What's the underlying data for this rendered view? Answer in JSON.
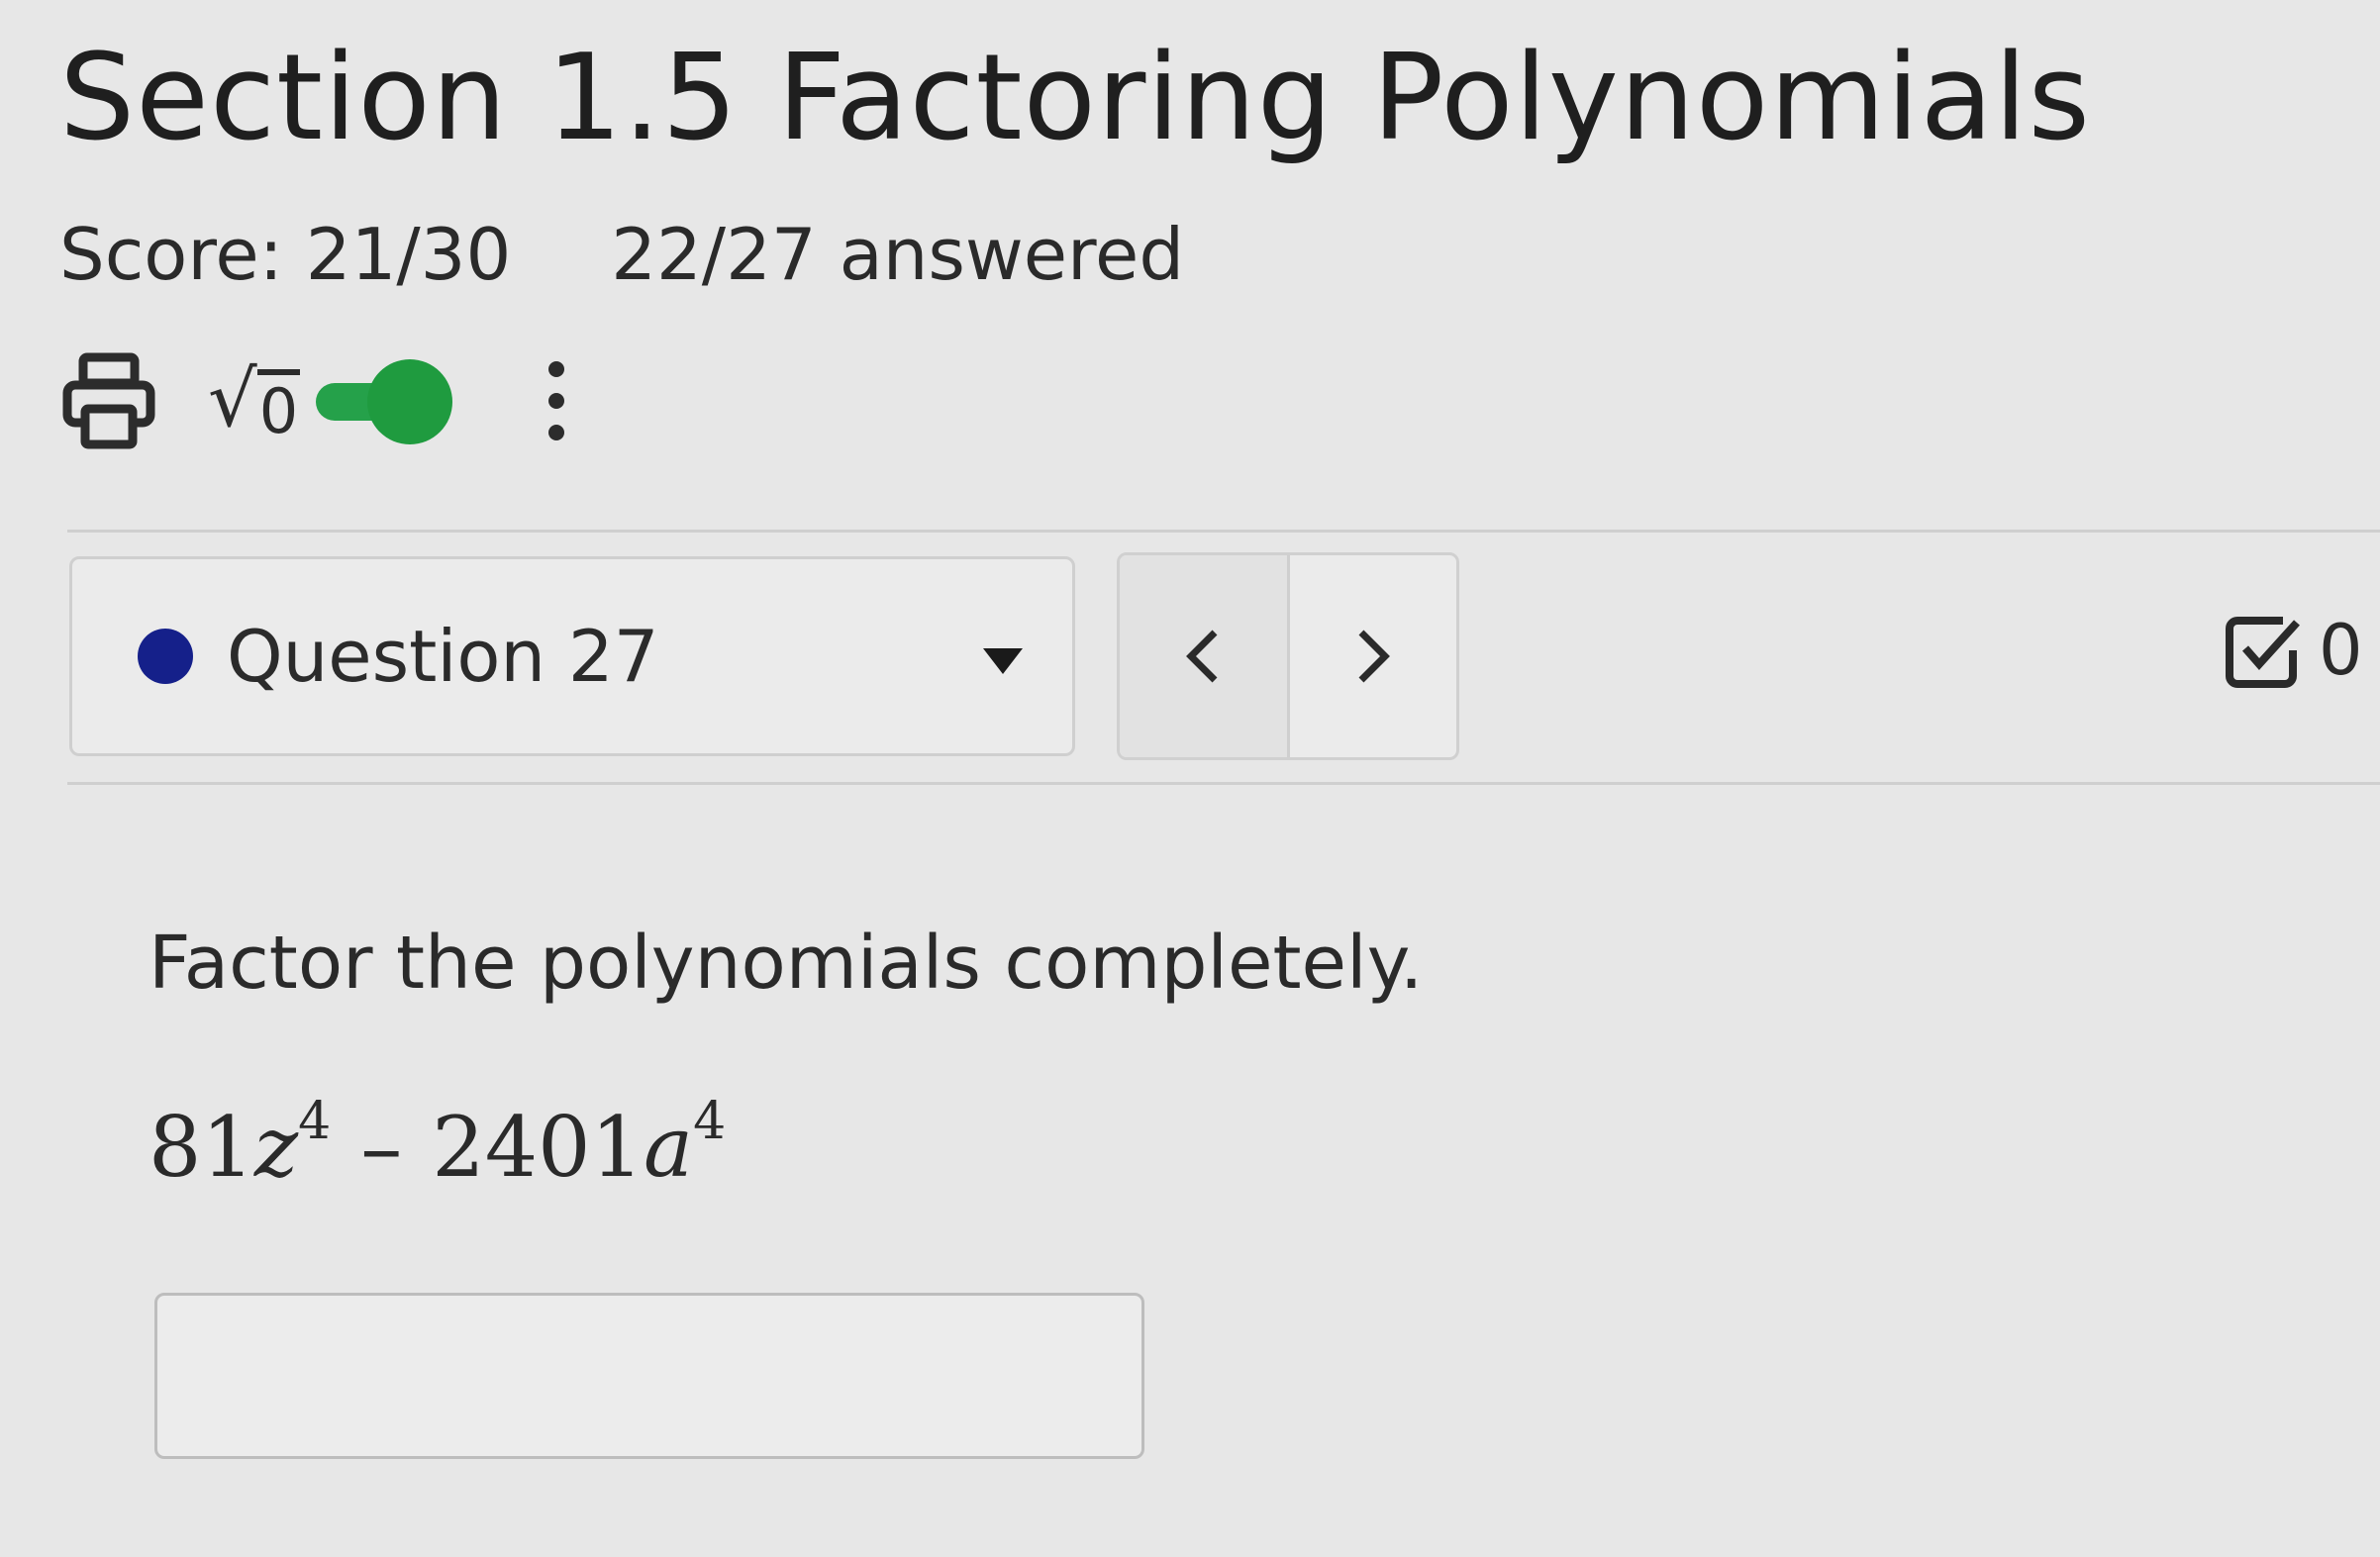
{
  "header": {
    "title": "Section 1.5 Factoring Polynomials",
    "score": "Score: 21/30",
    "answered": "22/27 answered"
  },
  "toolbar": {
    "icons": [
      "print-icon",
      "sqrt-icon",
      "toggle-switch",
      "kebab-menu-icon"
    ],
    "sqrt_radicand": "0",
    "toggle_on": true,
    "toggle_color": "#25a14a"
  },
  "question_nav": {
    "selected_question": "Question 27",
    "status_dot_color": "#15208a",
    "prev_label": "‹",
    "next_label": "›",
    "checked_count": "0"
  },
  "question": {
    "instruction": "Factor the polynomials completely.",
    "expression": {
      "term1_coef": "81",
      "term1_var": "z",
      "term1_exp": "4",
      "operator": "–",
      "term2_coef": "2401",
      "term2_var": "a",
      "term2_exp": "4"
    },
    "answer_value": ""
  }
}
